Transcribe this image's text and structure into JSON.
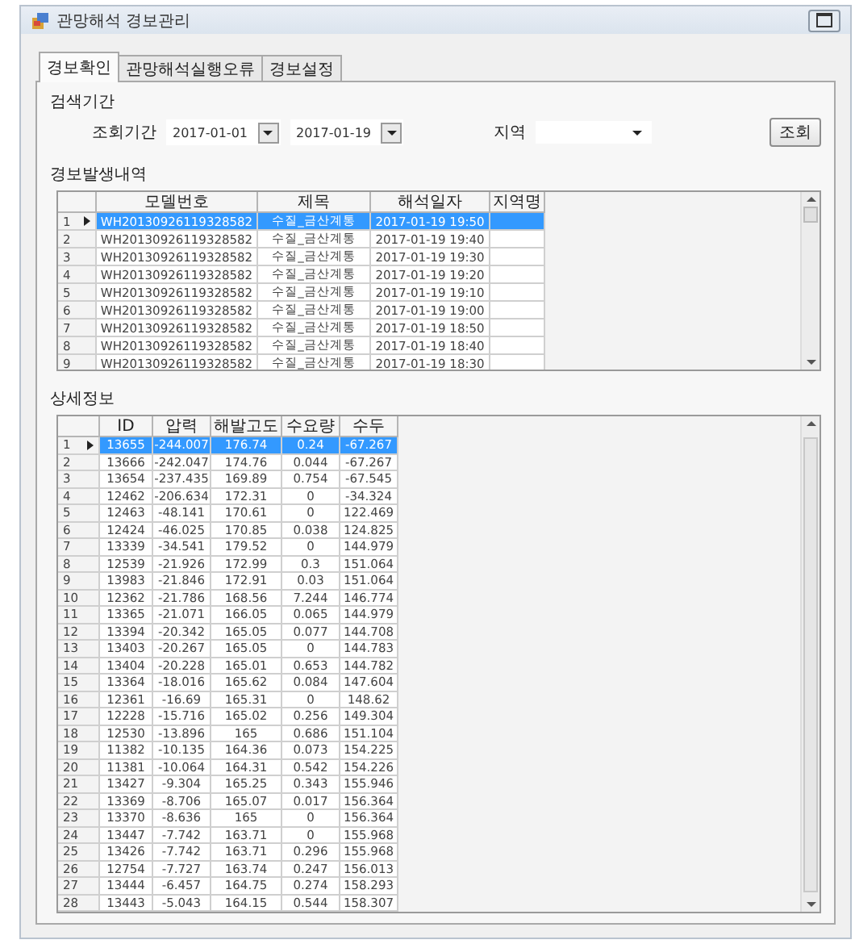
{
  "window": {
    "title": "관망해석 경보관리"
  },
  "tabs": [
    {
      "label": "경보확인",
      "selected": true
    },
    {
      "label": "관망해석실행오류",
      "selected": false
    },
    {
      "label": "경보설정",
      "selected": false
    }
  ],
  "search": {
    "group_title": "검색기간",
    "period_label": "조회기간",
    "start_date": "2017-01-01",
    "end_date": "2017-01-19",
    "region_label": "지역",
    "search_button": "조회"
  },
  "alarm_list": {
    "title": "경보발생내역",
    "columns": [
      "모델번호",
      "제목",
      "해석일자",
      "지역명"
    ],
    "rows": [
      {
        "number": "1",
        "selected": true,
        "cells": [
          "WH20130926119328582",
          "수질_금산계통",
          "2017-01-19 19:50",
          ""
        ]
      },
      {
        "number": "2",
        "selected": false,
        "cells": [
          "WH20130926119328582",
          "수질_금산계통",
          "2017-01-19 19:40",
          ""
        ]
      },
      {
        "number": "3",
        "selected": false,
        "cells": [
          "WH20130926119328582",
          "수질_금산계통",
          "2017-01-19 19:30",
          ""
        ]
      },
      {
        "number": "4",
        "selected": false,
        "cells": [
          "WH20130926119328582",
          "수질_금산계통",
          "2017-01-19 19:20",
          ""
        ]
      },
      {
        "number": "5",
        "selected": false,
        "cells": [
          "WH20130926119328582",
          "수질_금산계통",
          "2017-01-19 19:10",
          ""
        ]
      },
      {
        "number": "6",
        "selected": false,
        "cells": [
          "WH20130926119328582",
          "수질_금산계통",
          "2017-01-19 19:00",
          ""
        ]
      },
      {
        "number": "7",
        "selected": false,
        "cells": [
          "WH20130926119328582",
          "수질_금산계통",
          "2017-01-19 18:50",
          ""
        ]
      },
      {
        "number": "8",
        "selected": false,
        "cells": [
          "WH20130926119328582",
          "수질_금산계통",
          "2017-01-19 18:40",
          ""
        ]
      },
      {
        "number": "9",
        "selected": false,
        "cells": [
          "WH20130926119328582",
          "수질_금산계통",
          "2017-01-19 18:30",
          ""
        ]
      }
    ]
  },
  "details": {
    "title": "상세정보",
    "columns": [
      "ID",
      "압력",
      "해발고도",
      "수요량",
      "수두"
    ],
    "rows": [
      {
        "number": "1",
        "selected": true,
        "cells": [
          "13655",
          "-244.007",
          "176.74",
          "0.24",
          "-67.267"
        ]
      },
      {
        "number": "2",
        "selected": false,
        "cells": [
          "13666",
          "-242.047",
          "174.76",
          "0.044",
          "-67.267"
        ]
      },
      {
        "number": "3",
        "selected": false,
        "cells": [
          "13654",
          "-237.435",
          "169.89",
          "0.754",
          "-67.545"
        ]
      },
      {
        "number": "4",
        "selected": false,
        "cells": [
          "12462",
          "-206.634",
          "172.31",
          "0",
          "-34.324"
        ]
      },
      {
        "number": "5",
        "selected": false,
        "cells": [
          "12463",
          "-48.141",
          "170.61",
          "0",
          "122.469"
        ]
      },
      {
        "number": "6",
        "selected": false,
        "cells": [
          "12424",
          "-46.025",
          "170.85",
          "0.038",
          "124.825"
        ]
      },
      {
        "number": "7",
        "selected": false,
        "cells": [
          "13339",
          "-34.541",
          "179.52",
          "0",
          "144.979"
        ]
      },
      {
        "number": "8",
        "selected": false,
        "cells": [
          "12539",
          "-21.926",
          "172.99",
          "0.3",
          "151.064"
        ]
      },
      {
        "number": "9",
        "selected": false,
        "cells": [
          "13983",
          "-21.846",
          "172.91",
          "0.03",
          "151.064"
        ]
      },
      {
        "number": "10",
        "selected": false,
        "cells": [
          "12362",
          "-21.786",
          "168.56",
          "7.244",
          "146.774"
        ]
      },
      {
        "number": "11",
        "selected": false,
        "cells": [
          "13365",
          "-21.071",
          "166.05",
          "0.065",
          "144.979"
        ]
      },
      {
        "number": "12",
        "selected": false,
        "cells": [
          "13394",
          "-20.342",
          "165.05",
          "0.077",
          "144.708"
        ]
      },
      {
        "number": "13",
        "selected": false,
        "cells": [
          "13403",
          "-20.267",
          "165.05",
          "0",
          "144.783"
        ]
      },
      {
        "number": "14",
        "selected": false,
        "cells": [
          "13404",
          "-20.228",
          "165.01",
          "0.653",
          "144.782"
        ]
      },
      {
        "number": "15",
        "selected": false,
        "cells": [
          "13364",
          "-18.016",
          "165.62",
          "0.084",
          "147.604"
        ]
      },
      {
        "number": "16",
        "selected": false,
        "cells": [
          "12361",
          "-16.69",
          "165.31",
          "0",
          "148.62"
        ]
      },
      {
        "number": "17",
        "selected": false,
        "cells": [
          "12228",
          "-15.716",
          "165.02",
          "0.256",
          "149.304"
        ]
      },
      {
        "number": "18",
        "selected": false,
        "cells": [
          "12530",
          "-13.896",
          "165",
          "0.686",
          "151.104"
        ]
      },
      {
        "number": "19",
        "selected": false,
        "cells": [
          "11382",
          "-10.135",
          "164.36",
          "0.073",
          "154.225"
        ]
      },
      {
        "number": "20",
        "selected": false,
        "cells": [
          "11381",
          "-10.064",
          "164.31",
          "0.542",
          "154.226"
        ]
      },
      {
        "number": "21",
        "selected": false,
        "cells": [
          "13427",
          "-9.304",
          "165.25",
          "0.343",
          "155.946"
        ]
      },
      {
        "number": "22",
        "selected": false,
        "cells": [
          "13369",
          "-8.706",
          "165.07",
          "0.017",
          "156.364"
        ]
      },
      {
        "number": "23",
        "selected": false,
        "cells": [
          "13370",
          "-8.636",
          "165",
          "0",
          "156.364"
        ]
      },
      {
        "number": "24",
        "selected": false,
        "cells": [
          "13447",
          "-7.742",
          "163.71",
          "0",
          "155.968"
        ]
      },
      {
        "number": "25",
        "selected": false,
        "cells": [
          "13426",
          "-7.742",
          "163.71",
          "0.296",
          "155.968"
        ]
      },
      {
        "number": "26",
        "selected": false,
        "cells": [
          "12754",
          "-7.727",
          "163.74",
          "0.247",
          "156.013"
        ]
      },
      {
        "number": "27",
        "selected": false,
        "cells": [
          "13444",
          "-6.457",
          "164.75",
          "0.274",
          "158.293"
        ]
      },
      {
        "number": "28",
        "selected": false,
        "cells": [
          "13443",
          "-5.043",
          "164.15",
          "0.544",
          "158.307"
        ]
      }
    ]
  }
}
